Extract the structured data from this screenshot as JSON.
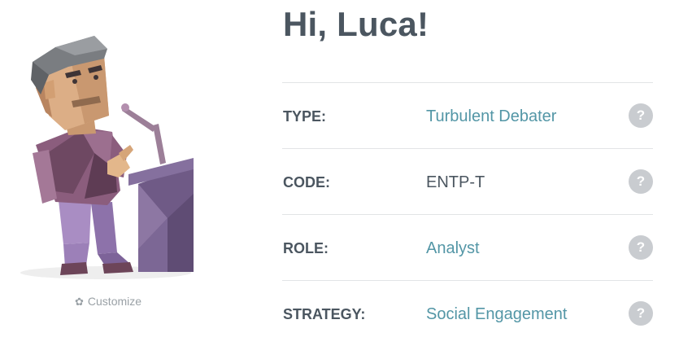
{
  "greeting": "Hi, Luca!",
  "customize": {
    "label": "Customize",
    "icon": "gear-icon"
  },
  "rows": [
    {
      "label": "TYPE:",
      "value": "Turbulent Debater",
      "linked": true
    },
    {
      "label": "CODE:",
      "value": "ENTP-T",
      "linked": false
    },
    {
      "label": "ROLE:",
      "value": "Analyst",
      "linked": true
    },
    {
      "label": "STRATEGY:",
      "value": "Social Engagement",
      "linked": true
    }
  ],
  "help_glyph": "?",
  "colors": {
    "heading": "#4b5660",
    "link": "#5396a6",
    "divider": "#e2e4e6",
    "help_bg": "#c9ccd0",
    "muted": "#9aa1a6"
  }
}
